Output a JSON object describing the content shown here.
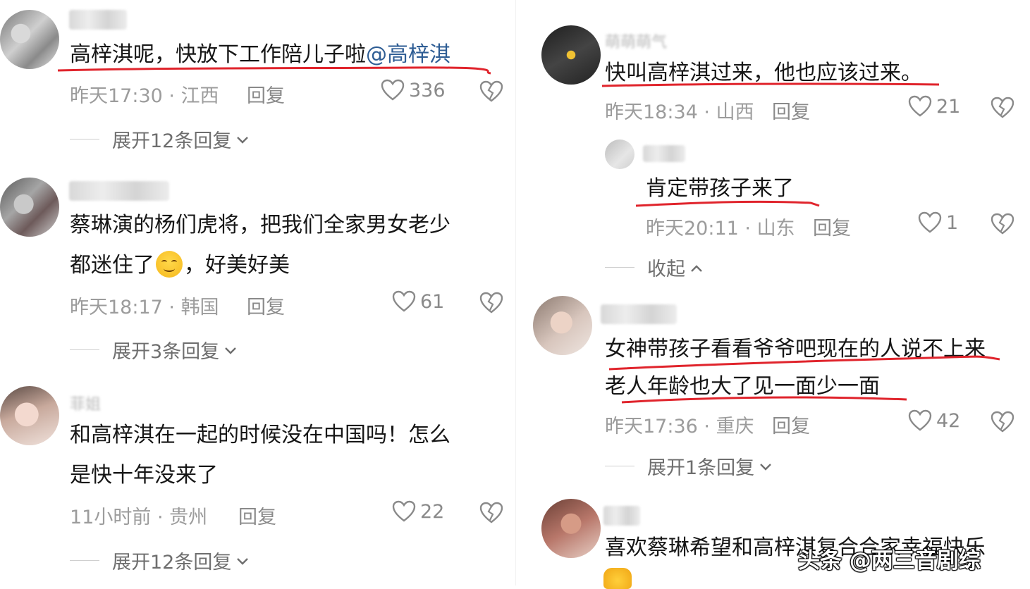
{
  "icons": {
    "like": "heart-outline-icon",
    "dislike": "broken-heart-outline-icon",
    "expand": "chevron-down-icon",
    "collapse": "chevron-up-icon"
  },
  "colors": {
    "text": "#161616",
    "meta": "#9c9c9c",
    "mention": "#2e5d94",
    "underline": "#e0242c"
  },
  "comments": [
    {
      "text": "高梓淇呢，快放下工作陪儿子啦",
      "mention": "@高梓淇",
      "time": "昨天17:30",
      "location": "江西",
      "reply": "回复",
      "likes": "336",
      "expand": "展开12条回复"
    },
    {
      "line1": "蔡琳演的杨们虎将，把我们全家男女老少",
      "line2_pre": "都迷住了",
      "line2_post": "，好美好美",
      "time": "昨天18:17",
      "location": "韩国",
      "reply": "回复",
      "likes": "61",
      "expand": "展开3条回复"
    },
    {
      "name": "菲姐",
      "line1": "和高梓淇在一起的时候没在中国吗！怎么",
      "line2": "是快十年没来了",
      "time": "11小时前",
      "location": "贵州",
      "reply": "回复",
      "likes": "22",
      "expand": "展开12条回复"
    },
    {
      "name": "萌萌萌气",
      "text": "快叫高梓淇过来，他也应该过来。",
      "time": "昨天18:34",
      "location": "山西",
      "reply": "回复",
      "likes": "21",
      "sub_reply": {
        "text": "肯定带孩子来了",
        "time": "昨天20:11",
        "location": "山东",
        "reply": "回复",
        "likes": "1"
      },
      "collapse": "收起"
    },
    {
      "line1": "女神带孩子看看爷爷吧现在的人说不上来",
      "line2": "老人年龄也大了见一面少一面",
      "time": "昨天17:36",
      "location": "重庆",
      "reply": "回复",
      "likes": "42",
      "expand": "展开1条回复"
    },
    {
      "text": "喜欢蔡琳希望和高梓淇复合合家幸福快乐"
    }
  ],
  "watermark": "头条 @两三音剧综"
}
